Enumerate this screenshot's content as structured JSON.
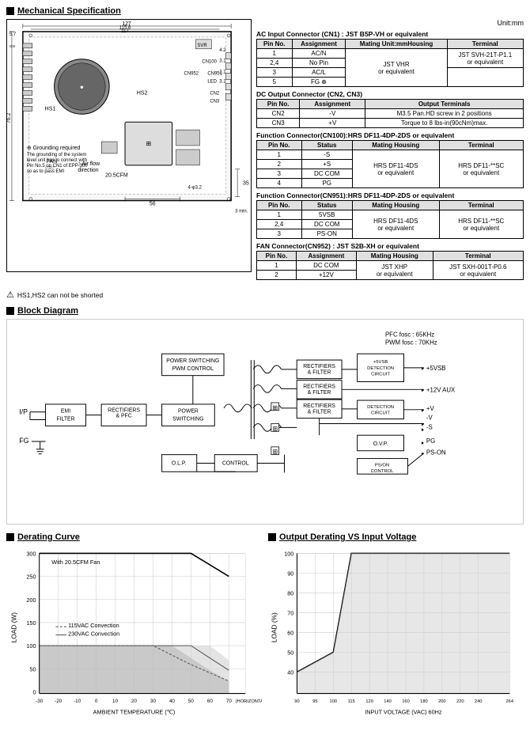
{
  "sections": {
    "mechanical": {
      "title": "Mechanical Specification",
      "unit": "Unit:mm",
      "hs_note": "HS1,HS2 can not be shorted"
    },
    "block": {
      "title": "Block Diagram",
      "pfc_note": "PFC fosc : 65KHz",
      "pwm_note": "PWM fosc : 70KHz"
    },
    "derating": {
      "title": "Derating Curve",
      "x_label": "AMBIENT TEMPERATURE (℃)"
    },
    "output_derating": {
      "title": "Output Derating VS Input Voltage",
      "x_label": "INPUT VOLTAGE (VAC) 60Hz"
    }
  },
  "connectors": [
    {
      "title": "AC Input Connector (CN1) : JST B5P-VH or equivalent",
      "columns": [
        "Pin No.",
        "Assignment",
        "Mating Housing",
        "Terminal"
      ],
      "rows": [
        [
          "1",
          "AC/N",
          "",
          ""
        ],
        [
          "2,4",
          "No Pin",
          "JST VHR",
          "JST SVH-21T-P1.1"
        ],
        [
          "3",
          "AC/L",
          "or equivalent",
          "or equivalent"
        ],
        [
          "5",
          "FG ⊕",
          "",
          ""
        ]
      ]
    },
    {
      "title": "DC Output Connector (CN2, CN3)",
      "columns": [
        "Pin No.",
        "Assignment",
        "Output Terminals"
      ],
      "rows": [
        [
          "CN2",
          "-V",
          "M3.5 Pan.HD screw in 2 positions"
        ],
        [
          "CN3",
          "+V",
          "Torque to 8 lbs-in(90cNm)max."
        ]
      ]
    },
    {
      "title": "Function Connector(CN100):HRS DF11-4DP-2DS or equivalent",
      "columns": [
        "Pin No.",
        "Status",
        "Mating Housing",
        "Terminal"
      ],
      "rows": [
        [
          "1",
          "-S",
          "",
          ""
        ],
        [
          "2",
          "+S",
          "HRS DF11-4DS",
          "HRS DF11-**SC"
        ],
        [
          "3",
          "DC COM",
          "or equivalent",
          "or equivalent"
        ],
        [
          "4",
          "PG",
          "",
          ""
        ]
      ]
    },
    {
      "title": "Function Connector(CN951):HRS DF11-4DP-2DS or equivalent",
      "columns": [
        "Pin No.",
        "Status",
        "Mating Housing",
        "Terminal"
      ],
      "rows": [
        [
          "1",
          "5VSB",
          "",
          ""
        ],
        [
          "2,4",
          "DC COM",
          "HRS DF11-4DS",
          "HRS DF11-**SC"
        ],
        [
          "3",
          "PS-ON",
          "or equivalent",
          "or equivalent"
        ]
      ]
    },
    {
      "title": "FAN Connector(CN952) : JST S2B-XH or equivalent",
      "columns": [
        "Pin No.",
        "Assignment",
        "Mating Housing",
        "Terminal"
      ],
      "rows": [
        [
          "1",
          "DC COM",
          "JST XHP",
          "JST SXH-001T-P0.6"
        ],
        [
          "2",
          "+12V",
          "or equivalent",
          "or equivalent"
        ]
      ]
    }
  ],
  "derating_curve": {
    "y_label": "LOAD (W)",
    "x_label": "AMBIENT TEMPERATURE (℃)",
    "y_max": 300,
    "annotations": [
      "With 20.5CFM Fan",
      "115VAC Convection",
      "230VAC Convection"
    ],
    "x_ticks": [
      "-30",
      "-20",
      "-10",
      "0",
      "10",
      "20",
      "30",
      "40",
      "50",
      "60",
      "70"
    ],
    "y_ticks": [
      "300",
      "250",
      "200",
      "150",
      "100",
      "50",
      "0"
    ],
    "x_axis_label": "AMBIENT TEMPERATURE (℃)"
  },
  "output_derating_curve": {
    "y_label": "LOAD (%)",
    "x_label": "INPUT VOLTAGE (VAC) 60Hz",
    "y_max": 100,
    "x_ticks": [
      "90",
      "95",
      "100",
      "115",
      "120",
      "140",
      "160",
      "180",
      "200",
      "220",
      "240",
      "264"
    ],
    "y_ticks": [
      "100",
      "90",
      "80",
      "70",
      "60",
      "50",
      "40"
    ],
    "x_axis_label": "INPUT VOLTAGE (VAC) 60Hz"
  },
  "block_diagram": {
    "nodes": [
      {
        "id": "ip",
        "label": "I/P"
      },
      {
        "id": "fg",
        "label": "FG"
      },
      {
        "id": "emi",
        "label": "EMI\nFILTER"
      },
      {
        "id": "rect_pfc",
        "label": "RECTIFIERS\n& PFC"
      },
      {
        "id": "power_sw_pwm",
        "label": "POWER SWITCHING\nPWM CONTROL"
      },
      {
        "id": "power_sw",
        "label": "POWER\nSWITCHING"
      },
      {
        "id": "rect1",
        "label": "RECTIFIERS\n& FILTER"
      },
      {
        "id": "rect2",
        "label": "RECTIFIERS\n& FILTER"
      },
      {
        "id": "rect3",
        "label": "RECTIFIERS\n& FILTER"
      },
      {
        "id": "detect_vsb",
        "label": "+5VSB\nDETECTION\nCIRCUIT"
      },
      {
        "id": "detect_main",
        "label": "DETECTION\nCIRCUIT"
      },
      {
        "id": "olp",
        "label": "O.L.P."
      },
      {
        "id": "control",
        "label": "CONTROL"
      },
      {
        "id": "ovp",
        "label": "O.V.P."
      },
      {
        "id": "pson_ctrl",
        "label": "PS/ON\nCONTROL"
      }
    ],
    "outputs": [
      "+5VSB",
      "+12V AUX",
      "+V",
      "-V",
      "-S",
      "PG",
      "PS-ON"
    ]
  }
}
